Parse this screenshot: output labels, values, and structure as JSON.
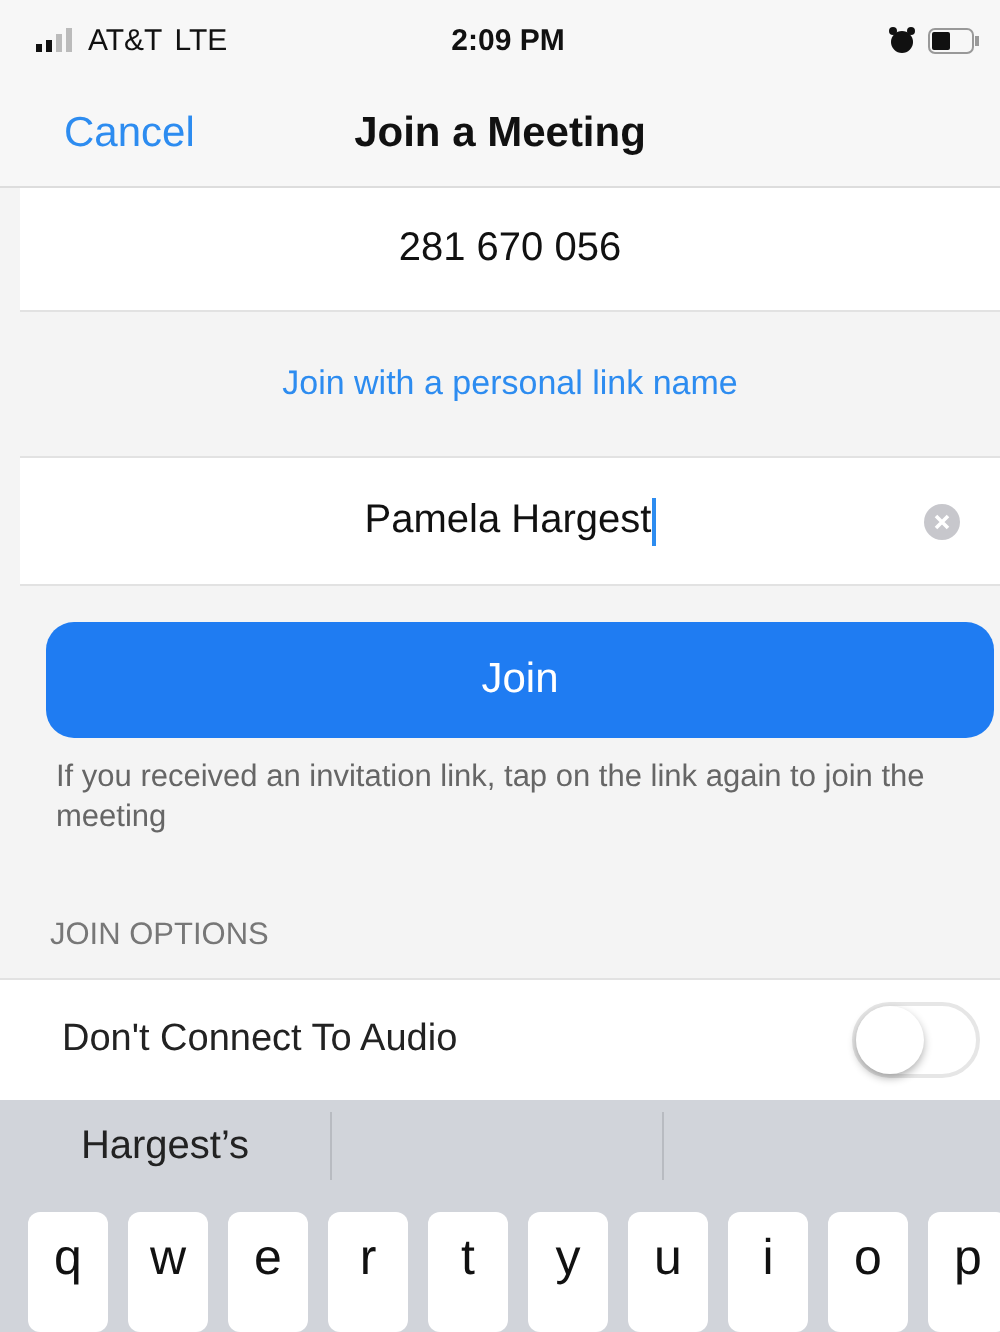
{
  "status_bar": {
    "carrier": "AT&T",
    "network": "LTE",
    "time": "2:09 PM"
  },
  "nav": {
    "cancel": "Cancel",
    "title": "Join a Meeting"
  },
  "meeting_id": {
    "value": "281 670 056"
  },
  "personal_link": "Join with a personal link name",
  "name_field": {
    "value": "Pamela Hargest"
  },
  "join_button": "Join",
  "hint": "If you received an invitation link, tap on the link again to join the meeting",
  "section_header": "JOIN OPTIONS",
  "options": [
    {
      "label": "Don't Connect To Audio",
      "on": false
    }
  ],
  "keyboard": {
    "suggestions": [
      "Hargest’s"
    ],
    "keys": [
      "q",
      "w",
      "e",
      "r",
      "t",
      "y",
      "u",
      "i",
      "o",
      "p"
    ]
  }
}
